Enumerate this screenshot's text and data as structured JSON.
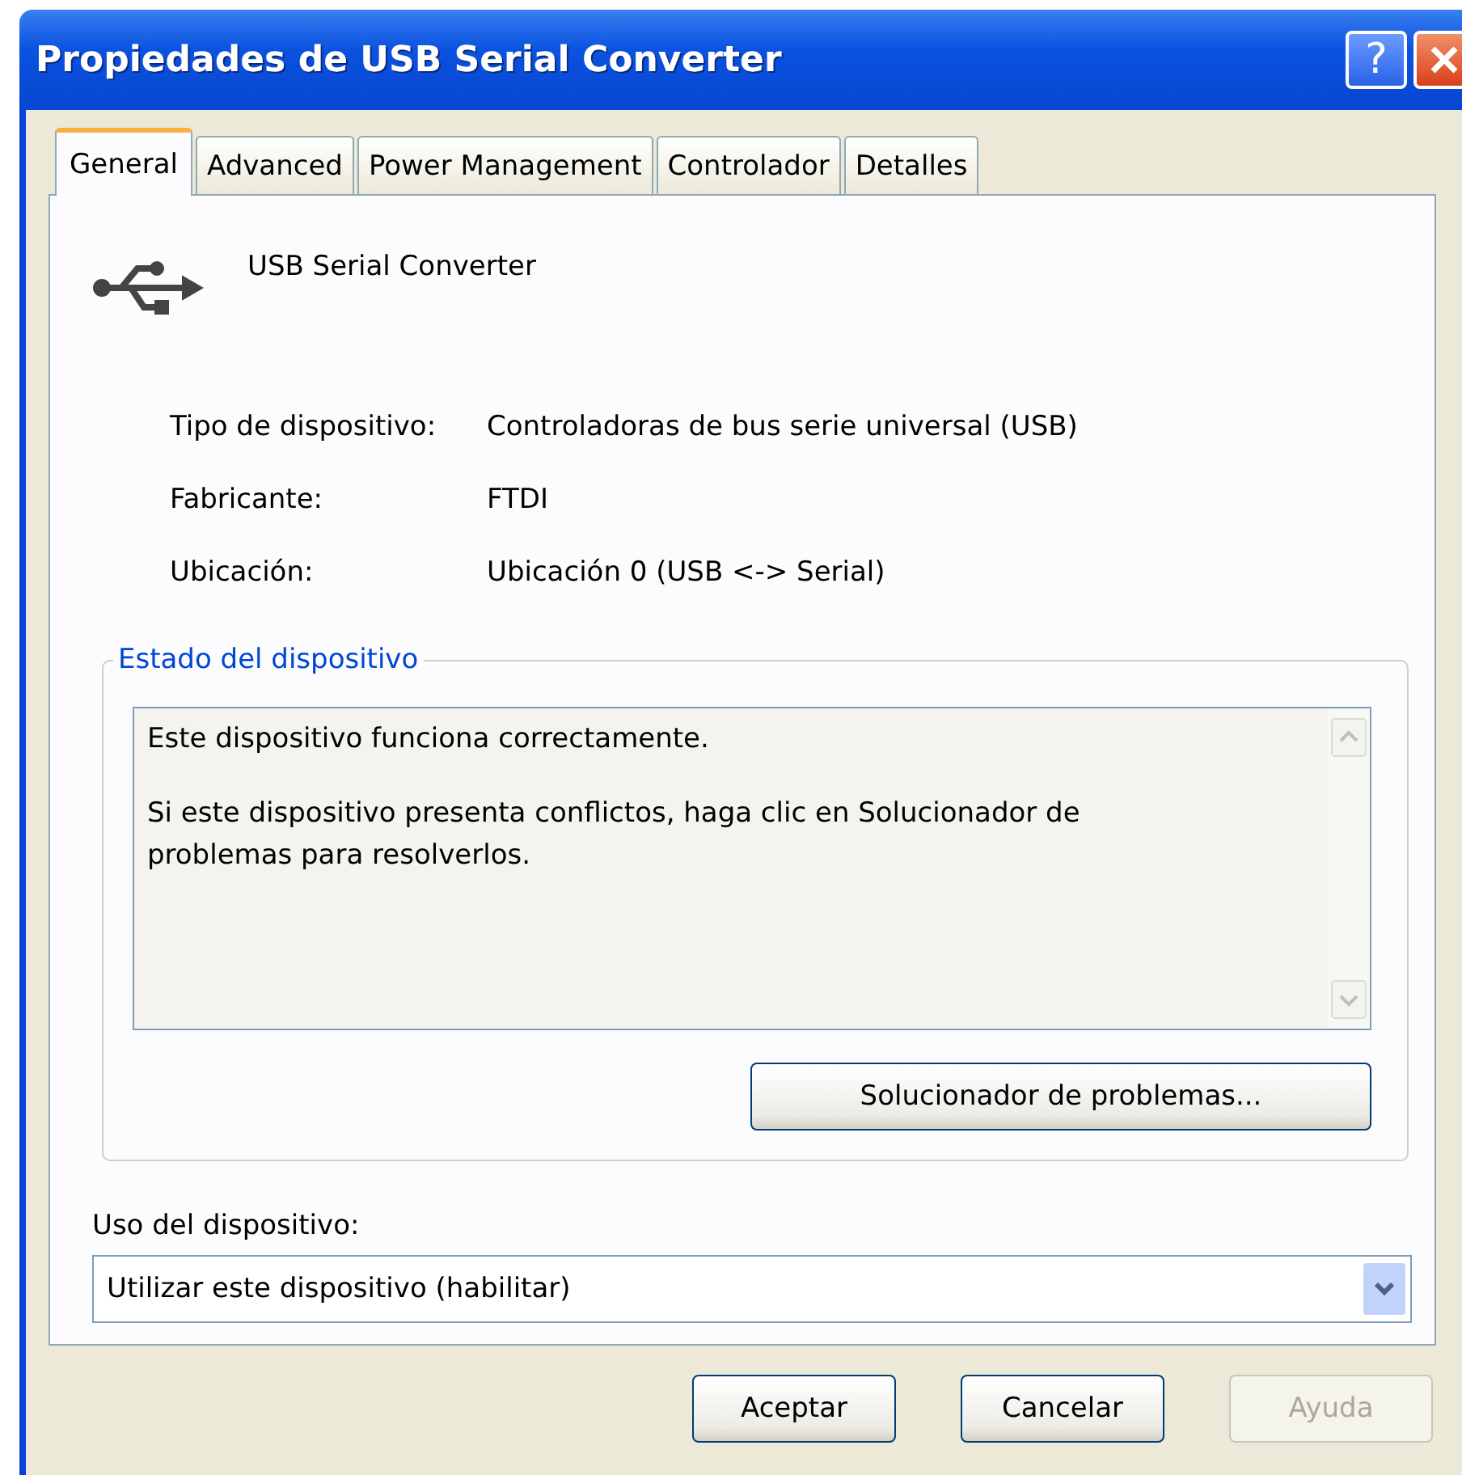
{
  "window": {
    "title": "Propiedades de USB Serial Converter",
    "help_button": "?"
  },
  "tabs": [
    {
      "label": "General",
      "selected": true
    },
    {
      "label": "Advanced",
      "selected": false
    },
    {
      "label": "Power Management",
      "selected": false
    },
    {
      "label": "Controlador",
      "selected": false
    },
    {
      "label": "Detalles",
      "selected": false
    }
  ],
  "device": {
    "name": "USB Serial Converter",
    "properties": [
      {
        "label": "Tipo de dispositivo:",
        "value": "Controladoras de bus serie universal (USB)"
      },
      {
        "label": "Fabricante:",
        "value": "FTDI"
      },
      {
        "label": "Ubicación:",
        "value": "Ubicación 0 (USB <-> Serial)"
      }
    ]
  },
  "status_group": {
    "title": "Estado del dispositivo",
    "lines": [
      "Este dispositivo funciona correctamente.",
      "Si este dispositivo presenta conflictos, haga clic en Solucionador de problemas para resolverlos."
    ],
    "button": "Solucionador de problemas..."
  },
  "usage": {
    "label": "Uso del dispositivo:",
    "value": "Utilizar este dispositivo (habilitar)"
  },
  "buttons": [
    {
      "label": "Aceptar",
      "disabled": false
    },
    {
      "label": "Cancelar",
      "disabled": false
    },
    {
      "label": "Ayuda",
      "disabled": true
    }
  ]
}
